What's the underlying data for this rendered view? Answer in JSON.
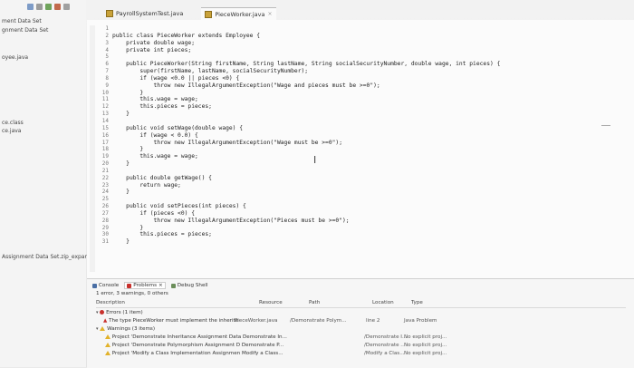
{
  "left_pane": {
    "items": [
      {
        "label": "ment Data Set"
      },
      {
        "label": "gnment Data Set"
      },
      {
        "label": "oyee.java"
      },
      {
        "label": "ce.class"
      },
      {
        "label": "ce.java"
      },
      {
        "label": "Assignment Data Set.zip_expande"
      }
    ]
  },
  "tabs": [
    {
      "label": "PayrollSystemTest.java"
    },
    {
      "label": "PieceWorker.java",
      "close": "×"
    }
  ],
  "editor": {
    "line_numbers": [
      "1",
      "2",
      "3",
      "4",
      "5",
      "6",
      "7",
      "8",
      "9",
      "10",
      "11",
      "12",
      "13",
      "14",
      "15",
      "16",
      "17",
      "18",
      "19",
      "20",
      "21",
      "22",
      "23",
      "24",
      "25",
      "26",
      "27",
      "28",
      "29",
      "30",
      "31"
    ],
    "lines": [
      "",
      "public class PieceWorker extends Employee {",
      "    private double wage;",
      "    private int pieces;",
      "",
      "    public PieceWorker(String firstName, String lastName, String socialSecurityNumber, double wage, int pieces) {",
      "        super(firstName, lastName, socialSecurityNumber);",
      "        if (wage <0.0 || pieces <0) {",
      "            throw new IllegalArgumentException(\"Wage and pieces must be >=0\");",
      "        }",
      "        this.wage = wage;",
      "        this.pieces = pieces;",
      "    }",
      "",
      "    public void setWage(double wage) {",
      "        if (wage < 0.0) {",
      "            throw new IllegalArgumentException(\"Wage must be >=0\");",
      "        }",
      "        this.wage = wage;",
      "    }",
      "",
      "    public double getWage() {",
      "        return wage;",
      "    }",
      "",
      "    public void setPieces(int pieces) {",
      "        if (pieces <0) {",
      "            throw new IllegalArgumentException(\"Pieces must be >=0\");",
      "        }",
      "        this.pieces = pieces;",
      "    }"
    ],
    "ibeam": "I"
  },
  "bottom": {
    "tabs": [
      {
        "label": "Console"
      },
      {
        "label": "Problems",
        "close": "×"
      },
      {
        "label": "Debug Shell"
      }
    ],
    "summary": "1 error, 3 warnings, 0 others",
    "headers": {
      "description": "Description",
      "resource": "Resource",
      "path": "Path",
      "location": "Location",
      "type": "Type"
    },
    "errors_group": "Errors (1 item)",
    "error_row": {
      "description": "The type PieceWorker must implement the inherite",
      "resource": "PieceWorker.java",
      "path": "/Demonstrate Polym...",
      "location": "line 2",
      "type": "Java Problem"
    },
    "warnings_group": "Warnings (3 items)",
    "warning_rows": [
      {
        "description": "Project 'Demonstrate Inheritance Assignment Data Demonstrate In...",
        "location": "/Demonstrate I...",
        "type": "No explicit proj..."
      },
      {
        "description": "Project 'Demonstrate Polymorphism Assignment D Demonstrate P...",
        "location": "/Demonstrate ...",
        "type": "No explicit proj..."
      },
      {
        "description": "Project 'Modify a Class Implementation Assignmen Modify a Class...",
        "location": "/Modify a Clas...",
        "type": "No explicit proj..."
      }
    ]
  }
}
